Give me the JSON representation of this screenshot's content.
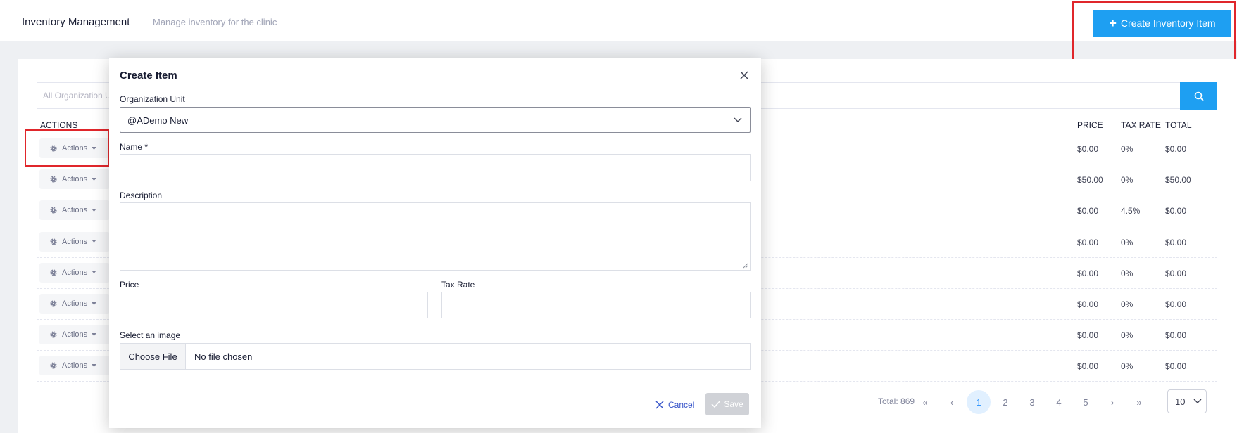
{
  "header": {
    "title": "Inventory Management",
    "subtitle": "Manage inventory for the clinic",
    "create_button_label": "Create Inventory Item"
  },
  "filters": {
    "org_unit_placeholder": "All Organization Units"
  },
  "table": {
    "columns": {
      "actions": "ACTIONS",
      "price": "PRICE",
      "tax_rate": "TAX RATE",
      "total": "TOTAL"
    },
    "action_label": "Actions",
    "rows": [
      {
        "price": "$0.00",
        "tax_rate": "0%",
        "total": "$0.00"
      },
      {
        "price": "$50.00",
        "tax_rate": "0%",
        "total": "$50.00"
      },
      {
        "price": "$0.00",
        "tax_rate": "4.5%",
        "total": "$0.00"
      },
      {
        "price": "$0.00",
        "tax_rate": "0%",
        "total": "$0.00"
      },
      {
        "price": "$0.00",
        "tax_rate": "0%",
        "total": "$0.00"
      },
      {
        "price": "$0.00",
        "tax_rate": "0%",
        "total": "$0.00"
      },
      {
        "price": "$0.00",
        "tax_rate": "0%",
        "total": "$0.00"
      },
      {
        "price": "$0.00",
        "tax_rate": "0%",
        "total": "$0.00"
      }
    ]
  },
  "pagination": {
    "total_label": "Total: 869",
    "first": "«",
    "prev": "‹",
    "pages": [
      "1",
      "2",
      "3",
      "4",
      "5"
    ],
    "active_page": "1",
    "next": "›",
    "last": "»",
    "page_size": "10"
  },
  "modal": {
    "title": "Create Item",
    "org_unit_label": "Organization Unit",
    "org_unit_value": "@ADemo New",
    "name_label": "Name *",
    "name_value": "",
    "description_label": "Description",
    "description_value": "",
    "price_label": "Price",
    "price_value": "",
    "tax_rate_label": "Tax Rate",
    "tax_rate_value": "",
    "image_label": "Select an image",
    "choose_file_label": "Choose File",
    "no_file_label": "No file chosen",
    "cancel_label": "Cancel",
    "save_label": "Save"
  },
  "colors": {
    "accent": "#1e9ff2",
    "highlight_box": "#e0262b",
    "link": "#3754c9",
    "disabled": "#d0d2d7"
  }
}
